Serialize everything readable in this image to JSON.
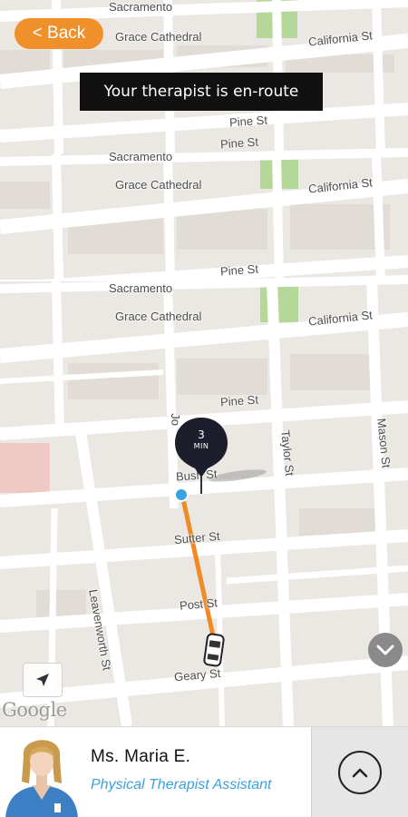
{
  "header": {
    "back_label": "< Back",
    "status_banner": "Your therapist is en-route"
  },
  "map": {
    "streets": {
      "sacramento_top": "Sacramento",
      "grace_cathedral_1": "Grace Cathedral",
      "california_st_1": "California St",
      "pine_st_1": "Pine St",
      "pine_st_2": "Pine St",
      "sacramento_2": "Sacramento",
      "grace_cathedral_2": "Grace Cathedral",
      "california_st_2": "California St",
      "pine_st_3": "Pine St",
      "sacramento_3": "Sacramento",
      "grace_cathedral_3": "Grace Cathedral",
      "california_st_3": "California St",
      "pine_st_4": "Pine St",
      "bush_st": "Bush St",
      "sutter_st": "Sutter St",
      "post_st": "Post St",
      "geary_st": "Geary St",
      "leavenworth_st": "Leavenworth St",
      "taylor_st": "Taylor St",
      "mason_st": "Mason St",
      "jones_st": "Jo"
    },
    "eta": {
      "value": "3",
      "unit": "MIN"
    },
    "route_color": "#f08a24",
    "origin_color": "#3aa2e0",
    "google_logo": "Google",
    "icons": {
      "locate": "navigation-arrow-icon",
      "collapse": "chevron-down-icon",
      "vehicle": "car-icon"
    }
  },
  "therapist": {
    "name": "Ms. Maria E.",
    "role": "Physical Therapist Assistant",
    "icons": {
      "expand": "chevron-up-icon"
    }
  },
  "colors": {
    "accent": "#f0902a",
    "role_text": "#3ba0e0",
    "banner_bg": "#111111",
    "park": "#b5d79a"
  }
}
